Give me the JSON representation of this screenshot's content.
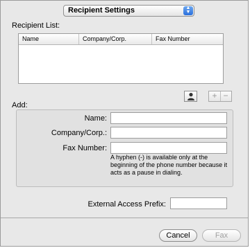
{
  "popup": {
    "selected": "Recipient Settings"
  },
  "recipient_list": {
    "label": "Recipient List:",
    "columns": [
      "Name",
      "Company/Corp.",
      "Fax Number"
    ]
  },
  "list_controls": {
    "address_book_icon": "person-icon",
    "add_symbol": "+",
    "remove_symbol": "−"
  },
  "add_section": {
    "label": "Add:",
    "name_label": "Name:",
    "name_value": "",
    "company_label": "Company/Corp.:",
    "company_value": "",
    "fax_label": "Fax Number:",
    "fax_value": "",
    "fax_note": "A hyphen (-) is available only at the beginning of the phone number because it acts as a pause in dialing."
  },
  "prefix": {
    "label": "External Access Prefix:",
    "value": ""
  },
  "buttons": {
    "cancel": "Cancel",
    "fax": "Fax"
  }
}
